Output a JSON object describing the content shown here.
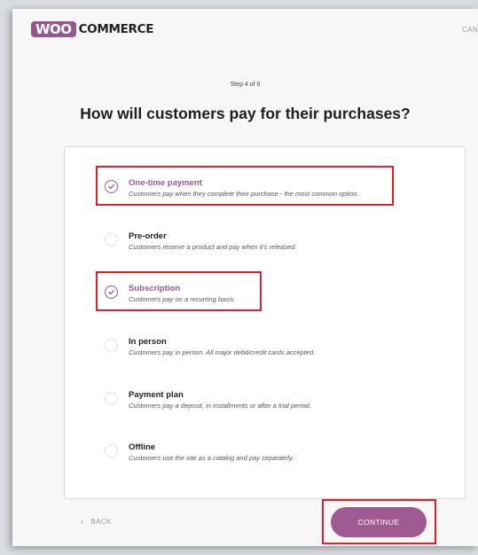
{
  "header": {
    "logo_woo": "WOO",
    "logo_commerce": "COMMERCE",
    "cancel_label": "CAN"
  },
  "step_label": "Step 4 of 6",
  "title": "How will customers pay for their purchases?",
  "options": [
    {
      "label": "One-time payment",
      "desc": "Customers pay when they complete their purchase - the most common option.",
      "checked": true
    },
    {
      "label": "Pre-order",
      "desc": "Customers reserve a product and pay when it's released.",
      "checked": false
    },
    {
      "label": "Subscription",
      "desc": "Customers pay on a recurring basis.",
      "checked": true
    },
    {
      "label": "In person",
      "desc": "Customers pay in person. All major debit/credit cards accepted.",
      "checked": false
    },
    {
      "label": "Payment plan",
      "desc": "Customers pay a deposit, in installments or after a trial period.",
      "checked": false
    },
    {
      "label": "Offline",
      "desc": "Customers use the site as a catalog and pay separately.",
      "checked": false
    }
  ],
  "footer": {
    "back_label": "BACK",
    "continue_label": "CONTINUE"
  },
  "colors": {
    "brand": "#96588a",
    "highlight": "#e0202e"
  }
}
